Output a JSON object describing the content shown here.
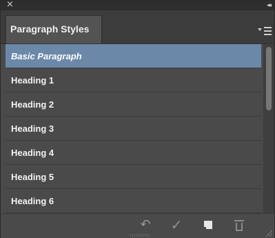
{
  "window": {
    "close_glyph": "×",
    "collapse_glyph": "◂◂"
  },
  "tabs": [
    {
      "label": "Paragraph Styles",
      "selected": true
    }
  ],
  "panel_menu": {
    "icon": "panel-menu-icon"
  },
  "styles": [
    {
      "label": "Basic Paragraph",
      "selected": true
    },
    {
      "label": "Heading 1",
      "selected": false
    },
    {
      "label": "Heading 2",
      "selected": false
    },
    {
      "label": "Heading 3",
      "selected": false
    },
    {
      "label": "Heading 4",
      "selected": false
    },
    {
      "label": "Heading 5",
      "selected": false
    },
    {
      "label": "Heading 6",
      "selected": false
    }
  ],
  "toolbar": {
    "clear_override_icon": "clear-override-icon",
    "apply_icon": "check-icon",
    "new_style_icon": "new-style-icon",
    "delete_icon": "trash-icon"
  },
  "colors": {
    "panel_bg": "#4a4a4a",
    "selection": "#6c88a9",
    "text": "#f2f2f2"
  }
}
